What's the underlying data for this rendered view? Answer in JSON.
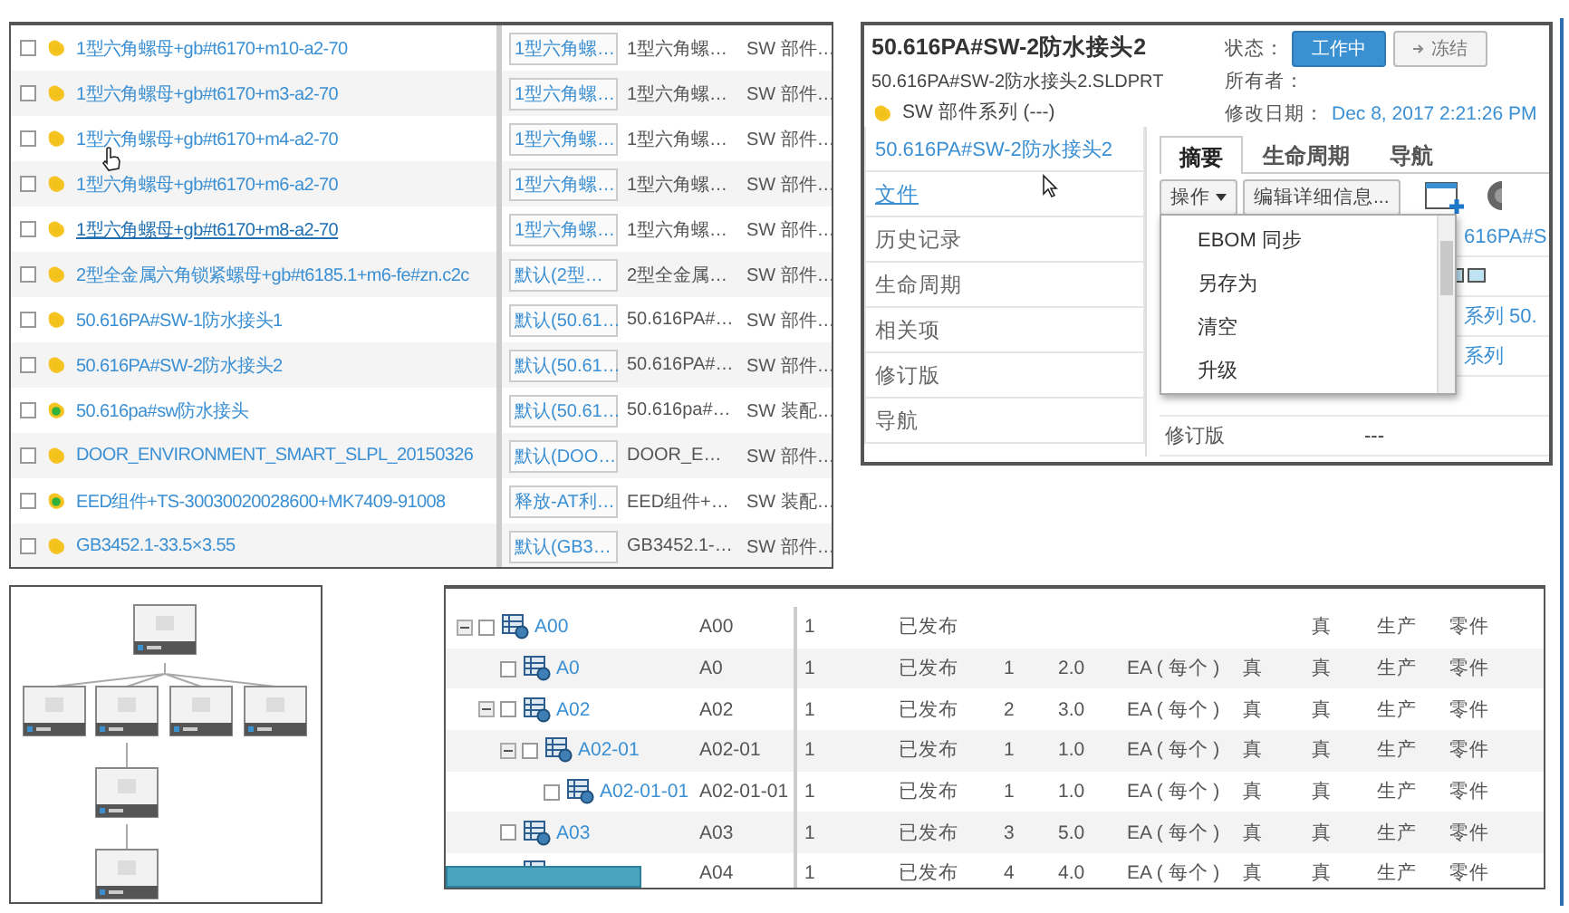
{
  "parts_list": {
    "rows": [
      {
        "kind": "part",
        "name": "1型六角螺母+gb#t6170+m10-a2-70",
        "hovered": false,
        "checked": false,
        "column_2": "1型六角螺…",
        "column_3": "1型六角螺…",
        "column_4": "SW 部件…"
      },
      {
        "kind": "part",
        "name": "1型六角螺母+gb#t6170+m3-a2-70",
        "hovered": false,
        "checked": false,
        "column_2": "1型六角螺…",
        "column_3": "1型六角螺…",
        "column_4": "SW 部件…"
      },
      {
        "kind": "part",
        "name": "1型六角螺母+gb#t6170+m4-a2-70",
        "hovered": false,
        "checked": false,
        "column_2": "1型六角螺…",
        "column_3": "1型六角螺…",
        "column_4": "SW 部件…"
      },
      {
        "kind": "part",
        "name": "1型六角螺母+gb#t6170+m6-a2-70",
        "hovered": false,
        "checked": false,
        "column_2": "1型六角螺…",
        "column_3": "1型六角螺…",
        "column_4": "SW 部件…"
      },
      {
        "kind": "part",
        "name": "1型六角螺母+gb#t6170+m8-a2-70",
        "hovered": true,
        "checked": false,
        "column_2": "1型六角螺…",
        "column_3": "1型六角螺…",
        "column_4": "SW 部件…"
      },
      {
        "kind": "part",
        "name": "2型全金属六角锁紧螺母+gb#t6185.1+m6-fe#zn.c2c",
        "hovered": false,
        "checked": false,
        "column_2": "默认(2型…",
        "column_3": "2型全金属…",
        "column_4": "SW 部件…"
      },
      {
        "kind": "part",
        "name": "50.616PA#SW-1防水接头1",
        "hovered": false,
        "checked": false,
        "column_2": "默认(50.61…",
        "column_3": "50.616PA#…",
        "column_4": "SW 部件…"
      },
      {
        "kind": "part",
        "name": "50.616PA#SW-2防水接头2",
        "hovered": false,
        "checked": false,
        "column_2": "默认(50.61…",
        "column_3": "50.616PA#…",
        "column_4": "SW 部件…"
      },
      {
        "kind": "assembly",
        "name": "50.616pa#sw防水接头",
        "hovered": false,
        "checked": false,
        "column_2": "默认(50.61…",
        "column_3": "50.616pa#…",
        "column_4": "SW 装配…"
      },
      {
        "kind": "part",
        "name": "DOOR_ENVIRONMENT_SMART_SLPL_20150326",
        "hovered": false,
        "checked": false,
        "column_2": "默认(DOO…",
        "column_3": "DOOR_E…",
        "column_4": "SW 部件…"
      },
      {
        "kind": "assembly",
        "name": "EED组件+TS-30030020028600+MK7409-91008",
        "hovered": false,
        "checked": false,
        "column_2": "释放-AT利…",
        "column_3": "EED组件+…",
        "column_4": "SW 装配…"
      },
      {
        "kind": "part",
        "name": "GB3452.1-33.5×3.55",
        "hovered": false,
        "checked": false,
        "column_2": "默认(GB3…",
        "column_3": "GB3452.1-…",
        "column_4": "SW 部件…"
      }
    ]
  },
  "details": {
    "title": "50.616PA#SW-2防水接头2",
    "file_name": "50.616PA#SW-2防水接头2.SLDPRT",
    "family": "SW 部件系列 (---)",
    "status_label": "状态：",
    "status_buttons": [
      {
        "label": "工作中",
        "selected": true
      },
      {
        "label": "冻结",
        "selected": false
      }
    ],
    "owner_label": "所有者：",
    "modified_label": "修改日期：",
    "modified_value": "Dec 8, 2017 2:21:26 PM",
    "nav": [
      {
        "kind": "heading",
        "label": "50.616PA#SW-2防水接头2"
      },
      {
        "kind": "link",
        "label": "文件"
      },
      {
        "kind": "plain",
        "label": "历史记录"
      },
      {
        "kind": "plain",
        "label": "生命周期"
      },
      {
        "kind": "plain",
        "label": "相关项"
      },
      {
        "kind": "plain",
        "label": "修订版"
      },
      {
        "kind": "plain",
        "label": "导航"
      }
    ],
    "tabs": [
      {
        "label": "摘要",
        "selected": true
      },
      {
        "label": "生命周期",
        "selected": false
      },
      {
        "label": "导航",
        "selected": false
      }
    ],
    "actions_button": "操作",
    "edit_button": "编辑详细信息...",
    "properties": [
      {
        "kind": "partial",
        "value": "616PA#S"
      },
      {
        "kind": "icons"
      },
      {
        "kind": "partial",
        "value": "系列 50."
      },
      {
        "kind": "partial",
        "value": "系列"
      },
      {
        "kind": "covered"
      },
      {
        "kind": "full",
        "label": "修订版",
        "value": "---"
      }
    ],
    "menu": {
      "items": [
        "EBOM 同步",
        "另存为",
        "清空",
        "升级"
      ]
    }
  },
  "structure": {
    "rows": [
      {
        "name": "A00",
        "expanded": true,
        "checked": false,
        "column_2": "A00",
        "column_3": "1",
        "column_5": "已发布",
        "column_10": "真",
        "column_11": "生产",
        "column_12": "零件",
        "children": [
          {
            "name": "A0",
            "checked": false,
            "column_2": "A0",
            "column_3": "1",
            "column_5": "已发布",
            "column_6": "1",
            "column_7": "2.0",
            "column_8": "EA ( 每个 )",
            "column_9": "真",
            "column_10": "真",
            "column_11": "生产",
            "column_12": "零件"
          },
          {
            "name": "A02",
            "expanded": true,
            "checked": false,
            "column_2": "A02",
            "column_3": "1",
            "column_5": "已发布",
            "column_6": "2",
            "column_7": "3.0",
            "column_8": "EA ( 每个 )",
            "column_9": "真",
            "column_10": "真",
            "column_11": "生产",
            "column_12": "零件",
            "children": [
              {
                "name": "A02-01",
                "expanded": true,
                "checked": false,
                "column_2": "A02-01",
                "column_3": "1",
                "column_5": "已发布",
                "column_6": "1",
                "column_7": "1.0",
                "column_8": "EA ( 每个 )",
                "column_9": "真",
                "column_10": "真",
                "column_11": "生产",
                "column_12": "零件",
                "children": [
                  {
                    "name": "A02-01-01",
                    "checked": false,
                    "column_2": "A02-01-01",
                    "column_3": "1",
                    "column_5": "已发布",
                    "column_6": "1",
                    "column_7": "1.0",
                    "column_8": "EA ( 每个 )",
                    "column_9": "真",
                    "column_10": "真",
                    "column_11": "生产",
                    "column_12": "零件"
                  }
                ]
              }
            ]
          },
          {
            "name": "A03",
            "checked": false,
            "column_2": "A03",
            "column_3": "1",
            "column_5": "已发布",
            "column_6": "3",
            "column_7": "5.0",
            "column_8": "EA ( 每个 )",
            "column_9": "真",
            "column_10": "真",
            "column_11": "生产",
            "column_12": "零件"
          },
          {
            "column_2": "A04",
            "column_3": "1",
            "column_5": "已发布",
            "column_6": "4",
            "column_7": "4.0",
            "column_8": "EA ( 每个 )",
            "column_9": "真",
            "column_10": "真",
            "column_11": "生产",
            "column_12": "零件"
          }
        ]
      }
    ]
  }
}
